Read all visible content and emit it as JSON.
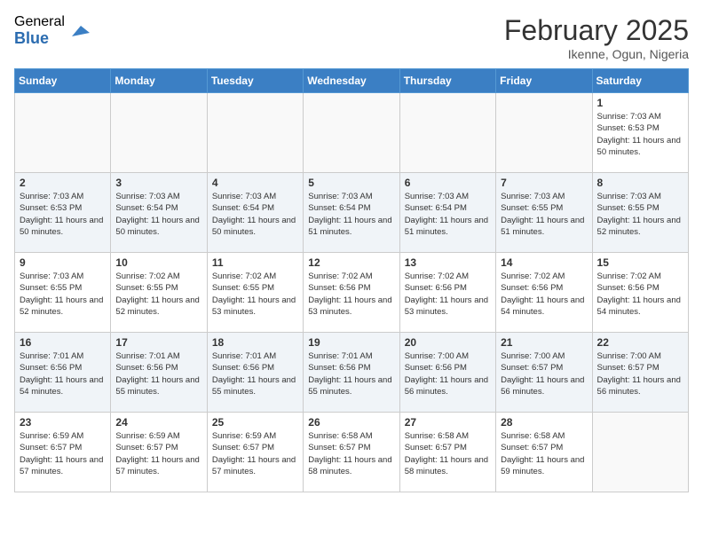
{
  "header": {
    "logo_general": "General",
    "logo_blue": "Blue",
    "month_title": "February 2025",
    "location": "Ikenne, Ogun, Nigeria"
  },
  "weekdays": [
    "Sunday",
    "Monday",
    "Tuesday",
    "Wednesday",
    "Thursday",
    "Friday",
    "Saturday"
  ],
  "weeks": [
    [
      {
        "day": "",
        "sunrise": "",
        "sunset": "",
        "daylight": ""
      },
      {
        "day": "",
        "sunrise": "",
        "sunset": "",
        "daylight": ""
      },
      {
        "day": "",
        "sunrise": "",
        "sunset": "",
        "daylight": ""
      },
      {
        "day": "",
        "sunrise": "",
        "sunset": "",
        "daylight": ""
      },
      {
        "day": "",
        "sunrise": "",
        "sunset": "",
        "daylight": ""
      },
      {
        "day": "",
        "sunrise": "",
        "sunset": "",
        "daylight": ""
      },
      {
        "day": "1",
        "sunrise": "Sunrise: 7:03 AM",
        "sunset": "Sunset: 6:53 PM",
        "daylight": "Daylight: 11 hours and 50 minutes."
      }
    ],
    [
      {
        "day": "2",
        "sunrise": "Sunrise: 7:03 AM",
        "sunset": "Sunset: 6:53 PM",
        "daylight": "Daylight: 11 hours and 50 minutes."
      },
      {
        "day": "3",
        "sunrise": "Sunrise: 7:03 AM",
        "sunset": "Sunset: 6:54 PM",
        "daylight": "Daylight: 11 hours and 50 minutes."
      },
      {
        "day": "4",
        "sunrise": "Sunrise: 7:03 AM",
        "sunset": "Sunset: 6:54 PM",
        "daylight": "Daylight: 11 hours and 50 minutes."
      },
      {
        "day": "5",
        "sunrise": "Sunrise: 7:03 AM",
        "sunset": "Sunset: 6:54 PM",
        "daylight": "Daylight: 11 hours and 51 minutes."
      },
      {
        "day": "6",
        "sunrise": "Sunrise: 7:03 AM",
        "sunset": "Sunset: 6:54 PM",
        "daylight": "Daylight: 11 hours and 51 minutes."
      },
      {
        "day": "7",
        "sunrise": "Sunrise: 7:03 AM",
        "sunset": "Sunset: 6:55 PM",
        "daylight": "Daylight: 11 hours and 51 minutes."
      },
      {
        "day": "8",
        "sunrise": "Sunrise: 7:03 AM",
        "sunset": "Sunset: 6:55 PM",
        "daylight": "Daylight: 11 hours and 52 minutes."
      }
    ],
    [
      {
        "day": "9",
        "sunrise": "Sunrise: 7:03 AM",
        "sunset": "Sunset: 6:55 PM",
        "daylight": "Daylight: 11 hours and 52 minutes."
      },
      {
        "day": "10",
        "sunrise": "Sunrise: 7:02 AM",
        "sunset": "Sunset: 6:55 PM",
        "daylight": "Daylight: 11 hours and 52 minutes."
      },
      {
        "day": "11",
        "sunrise": "Sunrise: 7:02 AM",
        "sunset": "Sunset: 6:55 PM",
        "daylight": "Daylight: 11 hours and 53 minutes."
      },
      {
        "day": "12",
        "sunrise": "Sunrise: 7:02 AM",
        "sunset": "Sunset: 6:56 PM",
        "daylight": "Daylight: 11 hours and 53 minutes."
      },
      {
        "day": "13",
        "sunrise": "Sunrise: 7:02 AM",
        "sunset": "Sunset: 6:56 PM",
        "daylight": "Daylight: 11 hours and 53 minutes."
      },
      {
        "day": "14",
        "sunrise": "Sunrise: 7:02 AM",
        "sunset": "Sunset: 6:56 PM",
        "daylight": "Daylight: 11 hours and 54 minutes."
      },
      {
        "day": "15",
        "sunrise": "Sunrise: 7:02 AM",
        "sunset": "Sunset: 6:56 PM",
        "daylight": "Daylight: 11 hours and 54 minutes."
      }
    ],
    [
      {
        "day": "16",
        "sunrise": "Sunrise: 7:01 AM",
        "sunset": "Sunset: 6:56 PM",
        "daylight": "Daylight: 11 hours and 54 minutes."
      },
      {
        "day": "17",
        "sunrise": "Sunrise: 7:01 AM",
        "sunset": "Sunset: 6:56 PM",
        "daylight": "Daylight: 11 hours and 55 minutes."
      },
      {
        "day": "18",
        "sunrise": "Sunrise: 7:01 AM",
        "sunset": "Sunset: 6:56 PM",
        "daylight": "Daylight: 11 hours and 55 minutes."
      },
      {
        "day": "19",
        "sunrise": "Sunrise: 7:01 AM",
        "sunset": "Sunset: 6:56 PM",
        "daylight": "Daylight: 11 hours and 55 minutes."
      },
      {
        "day": "20",
        "sunrise": "Sunrise: 7:00 AM",
        "sunset": "Sunset: 6:56 PM",
        "daylight": "Daylight: 11 hours and 56 minutes."
      },
      {
        "day": "21",
        "sunrise": "Sunrise: 7:00 AM",
        "sunset": "Sunset: 6:57 PM",
        "daylight": "Daylight: 11 hours and 56 minutes."
      },
      {
        "day": "22",
        "sunrise": "Sunrise: 7:00 AM",
        "sunset": "Sunset: 6:57 PM",
        "daylight": "Daylight: 11 hours and 56 minutes."
      }
    ],
    [
      {
        "day": "23",
        "sunrise": "Sunrise: 6:59 AM",
        "sunset": "Sunset: 6:57 PM",
        "daylight": "Daylight: 11 hours and 57 minutes."
      },
      {
        "day": "24",
        "sunrise": "Sunrise: 6:59 AM",
        "sunset": "Sunset: 6:57 PM",
        "daylight": "Daylight: 11 hours and 57 minutes."
      },
      {
        "day": "25",
        "sunrise": "Sunrise: 6:59 AM",
        "sunset": "Sunset: 6:57 PM",
        "daylight": "Daylight: 11 hours and 57 minutes."
      },
      {
        "day": "26",
        "sunrise": "Sunrise: 6:58 AM",
        "sunset": "Sunset: 6:57 PM",
        "daylight": "Daylight: 11 hours and 58 minutes."
      },
      {
        "day": "27",
        "sunrise": "Sunrise: 6:58 AM",
        "sunset": "Sunset: 6:57 PM",
        "daylight": "Daylight: 11 hours and 58 minutes."
      },
      {
        "day": "28",
        "sunrise": "Sunrise: 6:58 AM",
        "sunset": "Sunset: 6:57 PM",
        "daylight": "Daylight: 11 hours and 59 minutes."
      },
      {
        "day": "",
        "sunrise": "",
        "sunset": "",
        "daylight": ""
      }
    ]
  ]
}
